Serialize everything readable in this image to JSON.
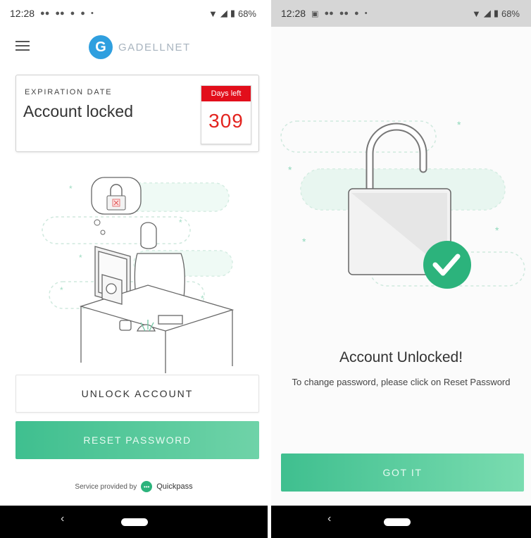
{
  "left_screen": {
    "status_bar": {
      "time": "12:28",
      "notification_icons": [
        "chat-icon",
        "chat-icon",
        "record-icon",
        "record-icon"
      ],
      "dot": "•",
      "battery": "68%"
    },
    "header": {
      "brand_letter": "G",
      "brand_name": "GADELLNET"
    },
    "expiration_card": {
      "label": "EXPIRATION DATE",
      "status": "Account locked",
      "days_left_label": "Days left",
      "days_left_value": "309"
    },
    "unlock_button_label": "UNLOCK ACCOUNT",
    "reset_button_label": "RESET PASSWORD",
    "footer": {
      "provided_by": "Service provided by",
      "provider_name": "Quickpass"
    },
    "nav": {
      "back": "‹"
    }
  },
  "right_screen": {
    "status_bar": {
      "time": "12:28",
      "notification_icons": [
        "image-icon",
        "chat-icon",
        "chat-icon",
        "record-icon"
      ],
      "dot": "•",
      "battery": "68%"
    },
    "title": "Account Unlocked!",
    "message": "To change password, please click on Reset Password",
    "got_it_button_label": "GOT IT",
    "nav": {
      "back": "‹"
    }
  },
  "colors": {
    "accent_green": "#3fbf8f",
    "days_red": "#e20e1b",
    "brand_blue": "#2f9fdf",
    "check_green": "#2cb37c"
  }
}
